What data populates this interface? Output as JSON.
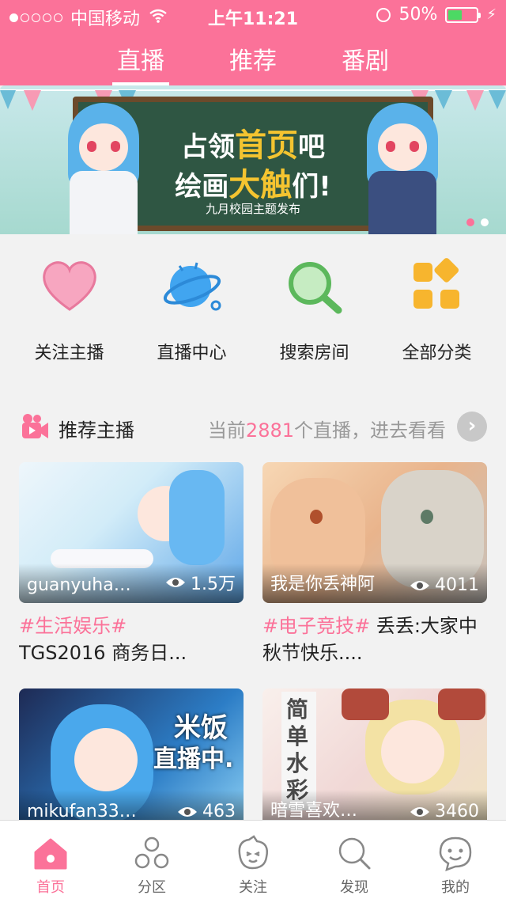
{
  "status_bar": {
    "carrier": "中国移动",
    "time": "上午11:21",
    "battery": "50%"
  },
  "top_tabs": [
    {
      "label": "直播",
      "active": true
    },
    {
      "label": "推荐",
      "active": false
    },
    {
      "label": "番剧",
      "active": false
    }
  ],
  "banner": {
    "line1_pre": "占领",
    "line1_hl": "首页",
    "line1_post": "吧",
    "line2_pre": "绘画",
    "line2_hl": "大触",
    "line2_post": "们!",
    "caption": "九月校园主题发布"
  },
  "quick_entries": [
    {
      "label": "关注主播",
      "icon": "heart-icon"
    },
    {
      "label": "直播中心",
      "icon": "planet-icon"
    },
    {
      "label": "搜索房间",
      "icon": "search-icon"
    },
    {
      "label": "全部分类",
      "icon": "category-icon"
    }
  ],
  "section": {
    "title": "推荐主播",
    "info_pre": "当前",
    "count": "2881",
    "info_post": "个直播，进去看看"
  },
  "cards": [
    {
      "name": "guanyuha…",
      "views": "1.5万",
      "tag": "#生活娱乐#",
      "title": "TGS2016 商务日..."
    },
    {
      "name": "我是你丢神阿",
      "views": "4011",
      "tag": "#电子竞技#",
      "title": " 丢丢:大家中秋节快乐...."
    },
    {
      "name": "mikufan33…",
      "views": "463",
      "tag": "",
      "title": ""
    },
    {
      "name": "暗雪喜欢…",
      "views": "3460",
      "tag": "",
      "title": ""
    }
  ],
  "card_art_text": {
    "c3": [
      "米饭",
      "直播中."
    ],
    "c4": "简单水彩"
  },
  "bottom_nav": [
    {
      "label": "首页",
      "icon": "home-icon",
      "active": true
    },
    {
      "label": "分区",
      "icon": "category-circles-icon",
      "active": false
    },
    {
      "label": "关注",
      "icon": "follow-face-icon",
      "active": false
    },
    {
      "label": "发现",
      "icon": "discover-search-icon",
      "active": false
    },
    {
      "label": "我的",
      "icon": "profile-face-icon",
      "active": false
    }
  ],
  "colors": {
    "brand_pink": "#fb7299",
    "gray_text": "#999999"
  }
}
